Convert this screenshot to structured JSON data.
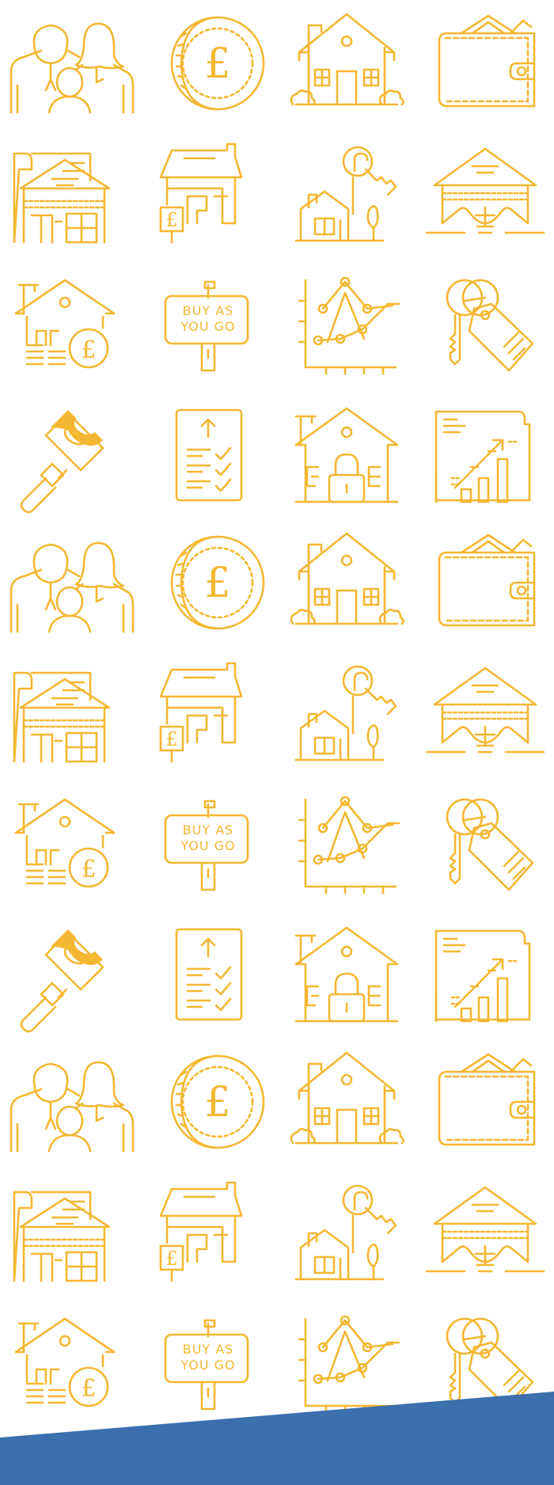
{
  "colors": {
    "icon_stroke": "#f4b731",
    "footer_band": "#3b6fae",
    "background": "#ffffff"
  },
  "icons": [
    {
      "name": "family-icon",
      "text": ""
    },
    {
      "name": "pound-coin-icon",
      "text": "£"
    },
    {
      "name": "house-icon",
      "text": ""
    },
    {
      "name": "wallet-icon",
      "text": ""
    },
    {
      "name": "house-document-icon",
      "text": ""
    },
    {
      "name": "house-extension-icon",
      "text": "£"
    },
    {
      "name": "house-key-icon",
      "text": ""
    },
    {
      "name": "house-foundation-icon",
      "text": ""
    },
    {
      "name": "house-savings-icon",
      "text": "£"
    },
    {
      "name": "buy-as-you-go-sign-icon",
      "text": "BUY AS\nYOU GO"
    },
    {
      "name": "line-chart-icon",
      "text": ""
    },
    {
      "name": "keys-tag-icon",
      "text": ""
    },
    {
      "name": "paint-roller-icon",
      "text": ""
    },
    {
      "name": "checklist-icon",
      "text": ""
    },
    {
      "name": "house-padlock-icon",
      "text": ""
    },
    {
      "name": "growth-report-icon",
      "text": ""
    },
    {
      "name": "family-icon",
      "text": ""
    },
    {
      "name": "pound-coin-icon",
      "text": "£"
    },
    {
      "name": "house-icon",
      "text": ""
    },
    {
      "name": "wallet-icon",
      "text": ""
    },
    {
      "name": "house-document-icon",
      "text": ""
    },
    {
      "name": "house-extension-icon",
      "text": "£"
    },
    {
      "name": "house-key-icon",
      "text": ""
    },
    {
      "name": "house-foundation-icon",
      "text": ""
    },
    {
      "name": "house-savings-icon",
      "text": "£"
    },
    {
      "name": "buy-as-you-go-sign-icon",
      "text": "BUY AS\nYOU GO"
    },
    {
      "name": "line-chart-icon",
      "text": ""
    },
    {
      "name": "keys-tag-icon",
      "text": ""
    },
    {
      "name": "paint-roller-icon",
      "text": ""
    },
    {
      "name": "checklist-icon",
      "text": ""
    },
    {
      "name": "house-padlock-icon",
      "text": ""
    },
    {
      "name": "growth-report-icon",
      "text": ""
    },
    {
      "name": "family-icon",
      "text": ""
    },
    {
      "name": "pound-coin-icon",
      "text": "£"
    },
    {
      "name": "house-icon",
      "text": ""
    },
    {
      "name": "wallet-icon",
      "text": ""
    },
    {
      "name": "house-document-icon",
      "text": ""
    },
    {
      "name": "house-extension-icon",
      "text": "£"
    },
    {
      "name": "house-key-icon",
      "text": ""
    },
    {
      "name": "house-foundation-icon",
      "text": ""
    },
    {
      "name": "house-savings-icon",
      "text": "£"
    },
    {
      "name": "buy-as-you-go-sign-icon",
      "text": "BUY AS\nYOU GO"
    },
    {
      "name": "line-chart-icon",
      "text": ""
    },
    {
      "name": "keys-tag-icon",
      "text": ""
    }
  ]
}
